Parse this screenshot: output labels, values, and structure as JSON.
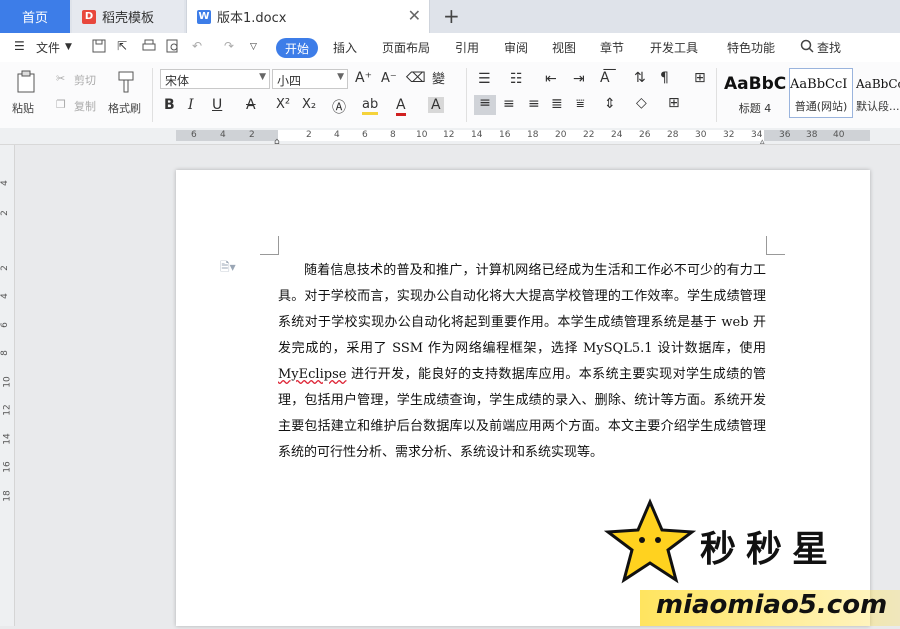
{
  "tabs": [
    {
      "label": "首页"
    },
    {
      "label": "稻壳模板"
    },
    {
      "label": "版本1.docx"
    }
  ],
  "menu": {
    "file": "文件",
    "items": [
      "开始",
      "插入",
      "页面布局",
      "引用",
      "审阅",
      "视图",
      "章节",
      "开发工具",
      "特色功能"
    ],
    "search": "查找"
  },
  "ribbon": {
    "paste": "粘贴",
    "cut": "剪切",
    "copy": "复制",
    "format_painter": "格式刷",
    "font_name": "宋体",
    "font_size": "小四",
    "styles": [
      {
        "preview": "AaBbC",
        "name": "标题 4"
      },
      {
        "preview": "AaBbCcI",
        "name": "普通(网站)"
      },
      {
        "preview": "AaBbCcI",
        "name": "默认段..."
      }
    ]
  },
  "ruler": {
    "ticks": [
      "6",
      "4",
      "2",
      "2",
      "4",
      "6",
      "8",
      "10",
      "12",
      "14",
      "16",
      "18",
      "20",
      "22",
      "24",
      "26",
      "28",
      "30",
      "32",
      "34",
      "36",
      "38",
      "40"
    ],
    "vticks": [
      "4",
      "2",
      "2",
      "4",
      "6",
      "8",
      "10",
      "12",
      "14",
      "16",
      "18"
    ]
  },
  "document": {
    "p1": "随着信息技术的普及和推广，计算机网络已经成为生活和工作必不可少的有力工具。对于学校而言，实现办公自动化将大大提高学校管理的工作效率。学生成绩管理系统对于学校实现办公自动化将起到重要作用。本学生成绩管理系统是基于 web 开发完成的，采用了 SSM 作为网络编程框架，选择 MySQL5.1 设计数据库，使用 ",
    "squiggle": "MyEclipse",
    "p2": " 进行开发，能良好的支持数据库应用。本系统主要实现对学生成绩的管理，包括用户管理，学生成绩查询，学生成绩的录入、删除、统计等方面。系统开发主要包括建立和维护后台数据库以及前端应用两个方面。本文主要介绍学生成绩管理系统的可行性分析、需求分析、系统设计和系统实现等。"
  },
  "watermark": {
    "text_cn": "秒秒星",
    "text_url": "miaomiao5.com"
  }
}
